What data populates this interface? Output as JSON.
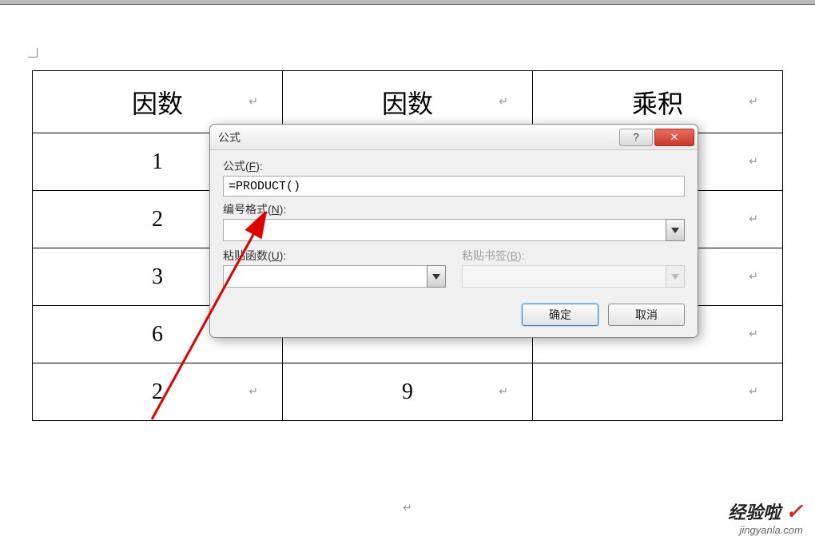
{
  "table": {
    "headers": [
      "因数",
      "因数",
      "乘积"
    ],
    "rows": [
      [
        "1",
        "",
        ""
      ],
      [
        "2",
        "",
        ""
      ],
      [
        "3",
        "",
        ""
      ],
      [
        "6",
        "",
        ""
      ],
      [
        "2",
        "9",
        ""
      ]
    ],
    "cell_marker": "↵"
  },
  "dialog": {
    "title": "公式",
    "help_symbol": "?",
    "close_symbol": "✕",
    "formula_label_prefix": "公式(",
    "formula_label_key": "F",
    "formula_label_suffix": "):",
    "formula_value": "=PRODUCT()",
    "format_label_prefix": "编号格式(",
    "format_label_key": "N",
    "format_label_suffix": "):",
    "format_value": "",
    "paste_func_label_prefix": "粘贴函数(",
    "paste_func_label_key": "U",
    "paste_func_label_suffix": "):",
    "paste_func_value": "",
    "paste_bm_label_prefix": "粘贴书签(",
    "paste_bm_label_key": "B",
    "paste_bm_label_suffix": "):",
    "paste_bm_value": "",
    "ok_label": "确定",
    "cancel_label": "取消"
  },
  "watermark": {
    "title": "经验啦",
    "check": "✓",
    "url": "jingyanla.com"
  },
  "after_marker": "↵"
}
